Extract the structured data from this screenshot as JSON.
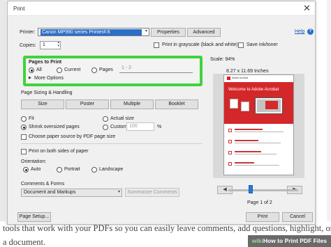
{
  "dialog": {
    "title": "Print",
    "close_label": "✕",
    "help_label": "Help",
    "printer_label": "Printer:",
    "printer_value": "Canon MP990 series Printer#:6",
    "properties_label": "Properties",
    "advanced_label": "Advanced",
    "copies_label": "Copies:",
    "copies_value": "1",
    "grayscale_label": "Print in grayscale (black and white)",
    "save_ink_label": "Save ink/toner"
  },
  "pages_to_print": {
    "heading": "Pages to Print",
    "all_label": "All",
    "current_label": "Current",
    "pages_label": "Pages",
    "pages_value": "1 - 2",
    "more_options_label": "More Options"
  },
  "sizing": {
    "heading": "Page Sizing & Handling",
    "tabs": [
      "Size",
      "Poster",
      "Multiple",
      "Booklet"
    ],
    "fit_label": "Fit",
    "actual_size_label": "Actual size",
    "shrink_label": "Shrink oversized pages",
    "custom_scale_label": "Custom Scale:",
    "custom_scale_value": "100",
    "percent_label": "%",
    "paper_source_label": "Choose paper source by PDF page size",
    "both_sides_label": "Print on both sides of paper",
    "orientation_label": "Orientation:",
    "auto_label": "Auto",
    "portrait_label": "Portrait",
    "landscape_label": "Landscape"
  },
  "comments": {
    "heading": "Comments & Forms",
    "select_value": "Document and Markups",
    "summarize_label": "Summarize Comments"
  },
  "preview": {
    "scale_label": "Scale:  94%",
    "size_label": "8.27 x 11.69 Inches",
    "page_indicator": "Page 1 of 2",
    "hero_title": "Welcome to Adobe Acrobat",
    "brand_text": "Adobe Acrobat",
    "prev_label": "◀",
    "next_label": "▶"
  },
  "footer": {
    "page_setup_label": "Page Setup...",
    "print_label": "Print",
    "cancel_label": "Cancel"
  },
  "background_text": {
    "line1": "tools that work with your PDFs so you can easily leave comments, add questions, highlight, or select",
    "line2": "a document."
  },
  "watermark": {
    "wiki": "wiki",
    "how": "How to Print PDF Files"
  },
  "colors": {
    "highlight": "#3fd33b",
    "printer_select": "#2a6fc9",
    "hero": "#d3272a"
  }
}
